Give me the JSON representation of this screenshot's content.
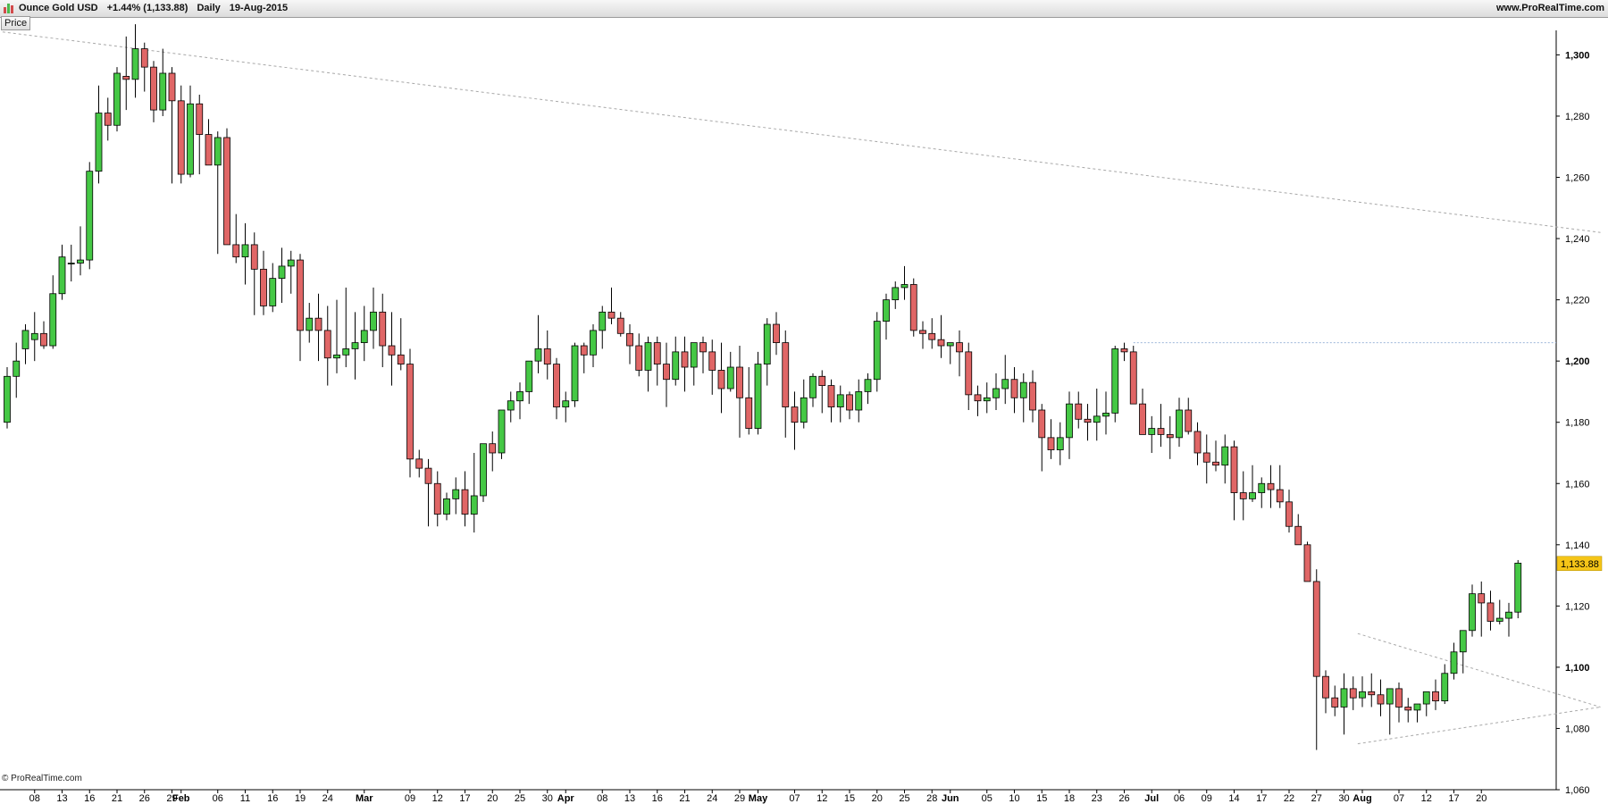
{
  "header": {
    "instrument": "Ounce Gold USD",
    "change": "+1.44% (1,133.88)",
    "period": "Daily",
    "date": "19-Aug-2015",
    "site": "www.ProRealTime.com",
    "logo_colors": [
      "#d24b4b",
      "#4cb84c",
      "#d24b4b"
    ]
  },
  "tabs": {
    "price": "Price"
  },
  "footer": {
    "copyright": "© ProRealTime.com"
  },
  "colors": {
    "up": "#45c845",
    "down": "#e06666",
    "wick": "#000000",
    "trend": "#a8a8a8",
    "level": "#9db6d9",
    "price_tag_bg": "#f5c518",
    "axis": "#000000"
  },
  "chart_data": {
    "type": "candlestick",
    "ylim": [
      1060,
      1308
    ],
    "y_ticks": [
      1060,
      1080,
      1100,
      1120,
      1140,
      1160,
      1180,
      1200,
      1220,
      1240,
      1260,
      1280,
      1300
    ],
    "y_tick_labels": [
      "1,060",
      "1,080",
      "1,100",
      "1,120",
      "1,140",
      "1,160",
      "1,180",
      "1,200",
      "1,220",
      "1,240",
      "1,260",
      "1,280",
      "1,300"
    ],
    "bold_y_ticks": [
      1100,
      1200,
      1300
    ],
    "x_ticks": [
      {
        "i": 3,
        "label": "08",
        "bold": false
      },
      {
        "i": 6,
        "label": "13",
        "bold": false
      },
      {
        "i": 9,
        "label": "16",
        "bold": false
      },
      {
        "i": 12,
        "label": "21",
        "bold": false
      },
      {
        "i": 15,
        "label": "26",
        "bold": false
      },
      {
        "i": 18,
        "label": "29",
        "bold": false
      },
      {
        "i": 19,
        "label": "Feb",
        "bold": true
      },
      {
        "i": 23,
        "label": "06",
        "bold": false
      },
      {
        "i": 26,
        "label": "11",
        "bold": false
      },
      {
        "i": 29,
        "label": "16",
        "bold": false
      },
      {
        "i": 32,
        "label": "19",
        "bold": false
      },
      {
        "i": 35,
        "label": "24",
        "bold": false
      },
      {
        "i": 39,
        "label": "Mar",
        "bold": true
      },
      {
        "i": 44,
        "label": "09",
        "bold": false
      },
      {
        "i": 47,
        "label": "12",
        "bold": false
      },
      {
        "i": 50,
        "label": "17",
        "bold": false
      },
      {
        "i": 53,
        "label": "20",
        "bold": false
      },
      {
        "i": 56,
        "label": "25",
        "bold": false
      },
      {
        "i": 59,
        "label": "30",
        "bold": false
      },
      {
        "i": 61,
        "label": "Apr",
        "bold": true
      },
      {
        "i": 65,
        "label": "08",
        "bold": false
      },
      {
        "i": 68,
        "label": "13",
        "bold": false
      },
      {
        "i": 71,
        "label": "16",
        "bold": false
      },
      {
        "i": 74,
        "label": "21",
        "bold": false
      },
      {
        "i": 77,
        "label": "24",
        "bold": false
      },
      {
        "i": 80,
        "label": "29",
        "bold": false
      },
      {
        "i": 82,
        "label": "May",
        "bold": true
      },
      {
        "i": 86,
        "label": "07",
        "bold": false
      },
      {
        "i": 89,
        "label": "12",
        "bold": false
      },
      {
        "i": 92,
        "label": "15",
        "bold": false
      },
      {
        "i": 95,
        "label": "20",
        "bold": false
      },
      {
        "i": 98,
        "label": "25",
        "bold": false
      },
      {
        "i": 101,
        "label": "28",
        "bold": false
      },
      {
        "i": 103,
        "label": "Jun",
        "bold": true
      },
      {
        "i": 107,
        "label": "05",
        "bold": false
      },
      {
        "i": 110,
        "label": "10",
        "bold": false
      },
      {
        "i": 113,
        "label": "15",
        "bold": false
      },
      {
        "i": 116,
        "label": "18",
        "bold": false
      },
      {
        "i": 119,
        "label": "23",
        "bold": false
      },
      {
        "i": 122,
        "label": "26",
        "bold": false
      },
      {
        "i": 125,
        "label": "Jul",
        "bold": true
      },
      {
        "i": 128,
        "label": "06",
        "bold": false
      },
      {
        "i": 131,
        "label": "09",
        "bold": false
      },
      {
        "i": 134,
        "label": "14",
        "bold": false
      },
      {
        "i": 137,
        "label": "17",
        "bold": false
      },
      {
        "i": 140,
        "label": "22",
        "bold": false
      },
      {
        "i": 143,
        "label": "27",
        "bold": false
      },
      {
        "i": 146,
        "label": "30",
        "bold": false
      },
      {
        "i": 148,
        "label": "Aug",
        "bold": true
      },
      {
        "i": 152,
        "label": "07",
        "bold": false
      },
      {
        "i": 155,
        "label": "12",
        "bold": false
      },
      {
        "i": 158,
        "label": "17",
        "bold": false
      },
      {
        "i": 161,
        "label": "20",
        "bold": false
      }
    ],
    "candles": [
      [
        1180,
        1198,
        1178,
        1195
      ],
      [
        1195,
        1206,
        1188,
        1200
      ],
      [
        1204,
        1212,
        1199,
        1210
      ],
      [
        1207,
        1216,
        1200,
        1209
      ],
      [
        1209,
        1213,
        1204,
        1205
      ],
      [
        1205,
        1228,
        1204,
        1222
      ],
      [
        1222,
        1238,
        1220,
        1234
      ],
      [
        1232,
        1238,
        1226,
        1232
      ],
      [
        1232,
        1244,
        1228,
        1233
      ],
      [
        1233,
        1265,
        1230,
        1262
      ],
      [
        1262,
        1290,
        1258,
        1281
      ],
      [
        1281,
        1286,
        1272,
        1277
      ],
      [
        1277,
        1296,
        1275,
        1294
      ],
      [
        1293,
        1306,
        1282,
        1292
      ],
      [
        1292,
        1310,
        1286,
        1302
      ],
      [
        1302,
        1304,
        1288,
        1296
      ],
      [
        1296,
        1298,
        1278,
        1282
      ],
      [
        1282,
        1302,
        1280,
        1294
      ],
      [
        1294,
        1296,
        1258,
        1285
      ],
      [
        1285,
        1290,
        1258,
        1261
      ],
      [
        1261,
        1290,
        1260,
        1284
      ],
      [
        1284,
        1287,
        1261,
        1274
      ],
      [
        1274,
        1279,
        1264,
        1264
      ],
      [
        1264,
        1275,
        1235,
        1273
      ],
      [
        1273,
        1276,
        1247,
        1238
      ],
      [
        1238,
        1248,
        1232,
        1234
      ],
      [
        1234,
        1245,
        1225,
        1238
      ],
      [
        1238,
        1242,
        1215,
        1230
      ],
      [
        1230,
        1236,
        1215,
        1218
      ],
      [
        1218,
        1232,
        1216,
        1227
      ],
      [
        1227,
        1237,
        1219,
        1231
      ],
      [
        1231,
        1236,
        1222,
        1233
      ],
      [
        1233,
        1235,
        1200,
        1210
      ],
      [
        1210,
        1219,
        1206,
        1214
      ],
      [
        1214,
        1222,
        1200,
        1210
      ],
      [
        1210,
        1218,
        1192,
        1201
      ],
      [
        1201,
        1220,
        1196,
        1202
      ],
      [
        1202,
        1224,
        1198,
        1204
      ],
      [
        1204,
        1216,
        1194,
        1206
      ],
      [
        1206,
        1218,
        1200,
        1210
      ],
      [
        1210,
        1224,
        1204,
        1216
      ],
      [
        1216,
        1222,
        1198,
        1205
      ],
      [
        1205,
        1216,
        1192,
        1202
      ],
      [
        1202,
        1214,
        1197,
        1199
      ],
      [
        1199,
        1204,
        1162,
        1168
      ],
      [
        1168,
        1171,
        1162,
        1165
      ],
      [
        1165,
        1168,
        1146,
        1160
      ],
      [
        1160,
        1164,
        1146,
        1150
      ],
      [
        1150,
        1157,
        1148,
        1155
      ],
      [
        1155,
        1162,
        1150,
        1158
      ],
      [
        1158,
        1164,
        1146,
        1150
      ],
      [
        1150,
        1170,
        1144,
        1156
      ],
      [
        1156,
        1172,
        1154,
        1173
      ],
      [
        1173,
        1177,
        1164,
        1170
      ],
      [
        1170,
        1182,
        1168,
        1184
      ],
      [
        1184,
        1190,
        1180,
        1187
      ],
      [
        1187,
        1193,
        1181,
        1190
      ],
      [
        1190,
        1198,
        1186,
        1200
      ],
      [
        1200,
        1215,
        1196,
        1204
      ],
      [
        1204,
        1210,
        1194,
        1199
      ],
      [
        1199,
        1201,
        1181,
        1185
      ],
      [
        1185,
        1190,
        1180,
        1187
      ],
      [
        1187,
        1206,
        1185,
        1205
      ],
      [
        1205,
        1206,
        1196,
        1202
      ],
      [
        1202,
        1212,
        1198,
        1210
      ],
      [
        1210,
        1218,
        1204,
        1216
      ],
      [
        1216,
        1224,
        1212,
        1214
      ],
      [
        1214,
        1216,
        1208,
        1209
      ],
      [
        1209,
        1212,
        1199,
        1205
      ],
      [
        1205,
        1209,
        1195,
        1197
      ],
      [
        1197,
        1208,
        1190,
        1206
      ],
      [
        1206,
        1208,
        1192,
        1199
      ],
      [
        1199,
        1206,
        1185,
        1194
      ],
      [
        1194,
        1208,
        1192,
        1203
      ],
      [
        1203,
        1208,
        1190,
        1198
      ],
      [
        1198,
        1205,
        1192,
        1206
      ],
      [
        1206,
        1208,
        1196,
        1203
      ],
      [
        1203,
        1207,
        1189,
        1197
      ],
      [
        1197,
        1206,
        1183,
        1191
      ],
      [
        1191,
        1203,
        1190,
        1198
      ],
      [
        1198,
        1205,
        1175,
        1188
      ],
      [
        1188,
        1198,
        1176,
        1178
      ],
      [
        1178,
        1203,
        1176,
        1199
      ],
      [
        1199,
        1214,
        1192,
        1212
      ],
      [
        1212,
        1216,
        1202,
        1206
      ],
      [
        1206,
        1210,
        1175,
        1185
      ],
      [
        1185,
        1190,
        1171,
        1180
      ],
      [
        1180,
        1194,
        1178,
        1188
      ],
      [
        1188,
        1196,
        1185,
        1195
      ],
      [
        1195,
        1197,
        1183,
        1192
      ],
      [
        1192,
        1194,
        1180,
        1185
      ],
      [
        1185,
        1192,
        1180,
        1189
      ],
      [
        1189,
        1190,
        1181,
        1184
      ],
      [
        1184,
        1194,
        1180,
        1190
      ],
      [
        1190,
        1196,
        1186,
        1194
      ],
      [
        1194,
        1216,
        1190,
        1213
      ],
      [
        1213,
        1222,
        1207,
        1220
      ],
      [
        1220,
        1226,
        1217,
        1224
      ],
      [
        1224,
        1231,
        1220,
        1225
      ],
      [
        1225,
        1227,
        1208,
        1210
      ],
      [
        1210,
        1213,
        1204,
        1209
      ],
      [
        1209,
        1214,
        1204,
        1207
      ],
      [
        1207,
        1215,
        1201,
        1205
      ],
      [
        1205,
        1206,
        1199,
        1206
      ],
      [
        1206,
        1210,
        1195,
        1203
      ],
      [
        1203,
        1206,
        1184,
        1189
      ],
      [
        1189,
        1192,
        1182,
        1187
      ],
      [
        1187,
        1193,
        1183,
        1188
      ],
      [
        1188,
        1196,
        1184,
        1191
      ],
      [
        1191,
        1202,
        1186,
        1194
      ],
      [
        1194,
        1198,
        1183,
        1188
      ],
      [
        1188,
        1196,
        1180,
        1193
      ],
      [
        1193,
        1197,
        1180,
        1184
      ],
      [
        1184,
        1186,
        1164,
        1175
      ],
      [
        1175,
        1181,
        1168,
        1171
      ],
      [
        1171,
        1180,
        1166,
        1175
      ],
      [
        1175,
        1190,
        1168,
        1186
      ],
      [
        1186,
        1190,
        1178,
        1181
      ],
      [
        1181,
        1186,
        1174,
        1180
      ],
      [
        1180,
        1191,
        1174,
        1182
      ],
      [
        1182,
        1190,
        1176,
        1183
      ],
      [
        1183,
        1205,
        1180,
        1204
      ],
      [
        1204,
        1206,
        1200,
        1203
      ],
      [
        1203,
        1205,
        1186,
        1186
      ],
      [
        1186,
        1191,
        1178,
        1176
      ],
      [
        1176,
        1182,
        1170,
        1178
      ],
      [
        1178,
        1186,
        1172,
        1176
      ],
      [
        1176,
        1182,
        1168,
        1175
      ],
      [
        1175,
        1188,
        1172,
        1184
      ],
      [
        1184,
        1188,
        1176,
        1177
      ],
      [
        1177,
        1180,
        1166,
        1170
      ],
      [
        1170,
        1176,
        1160,
        1167
      ],
      [
        1167,
        1174,
        1164,
        1166
      ],
      [
        1166,
        1176,
        1160,
        1172
      ],
      [
        1172,
        1174,
        1148,
        1157
      ],
      [
        1157,
        1164,
        1148,
        1155
      ],
      [
        1155,
        1166,
        1154,
        1157
      ],
      [
        1157,
        1162,
        1152,
        1160
      ],
      [
        1160,
        1166,
        1152,
        1158
      ],
      [
        1158,
        1166,
        1152,
        1154
      ],
      [
        1154,
        1158,
        1144,
        1146
      ],
      [
        1146,
        1150,
        1141,
        1140
      ],
      [
        1140,
        1141,
        1130,
        1128
      ],
      [
        1128,
        1132,
        1073,
        1097
      ],
      [
        1097,
        1099,
        1085,
        1090
      ],
      [
        1090,
        1094,
        1084,
        1087
      ],
      [
        1087,
        1098,
        1078,
        1093
      ],
      [
        1093,
        1097,
        1086,
        1090
      ],
      [
        1090,
        1097,
        1087,
        1092
      ],
      [
        1092,
        1098,
        1087,
        1091
      ],
      [
        1091,
        1096,
        1084,
        1088
      ],
      [
        1088,
        1092,
        1078,
        1093
      ],
      [
        1093,
        1095,
        1082,
        1087
      ],
      [
        1087,
        1090,
        1082,
        1086
      ],
      [
        1086,
        1088,
        1082,
        1088
      ],
      [
        1088,
        1092,
        1084,
        1092
      ],
      [
        1092,
        1096,
        1086,
        1089
      ],
      [
        1089,
        1101,
        1088,
        1098
      ],
      [
        1098,
        1108,
        1096,
        1105
      ],
      [
        1105,
        1110,
        1098,
        1112
      ],
      [
        1112,
        1127,
        1110,
        1124
      ],
      [
        1124,
        1128,
        1110,
        1121
      ],
      [
        1121,
        1125,
        1112,
        1115
      ],
      [
        1115,
        1122,
        1114,
        1116
      ],
      [
        1116,
        1121,
        1110,
        1118
      ],
      [
        1118,
        1135,
        1116,
        1134
      ]
    ],
    "current_price": 1133.88,
    "current_price_label": "1,133.88",
    "resistance_level": 1206,
    "trendlines": [
      {
        "x1": -0.5,
        "y1": 1307.5,
        "x2": 174,
        "y2": 1242
      },
      {
        "x1": 147.5,
        "y1": 1111,
        "x2": 174,
        "y2": 1087
      },
      {
        "x1": 147.5,
        "y1": 1075,
        "x2": 174,
        "y2": 1087
      }
    ]
  }
}
